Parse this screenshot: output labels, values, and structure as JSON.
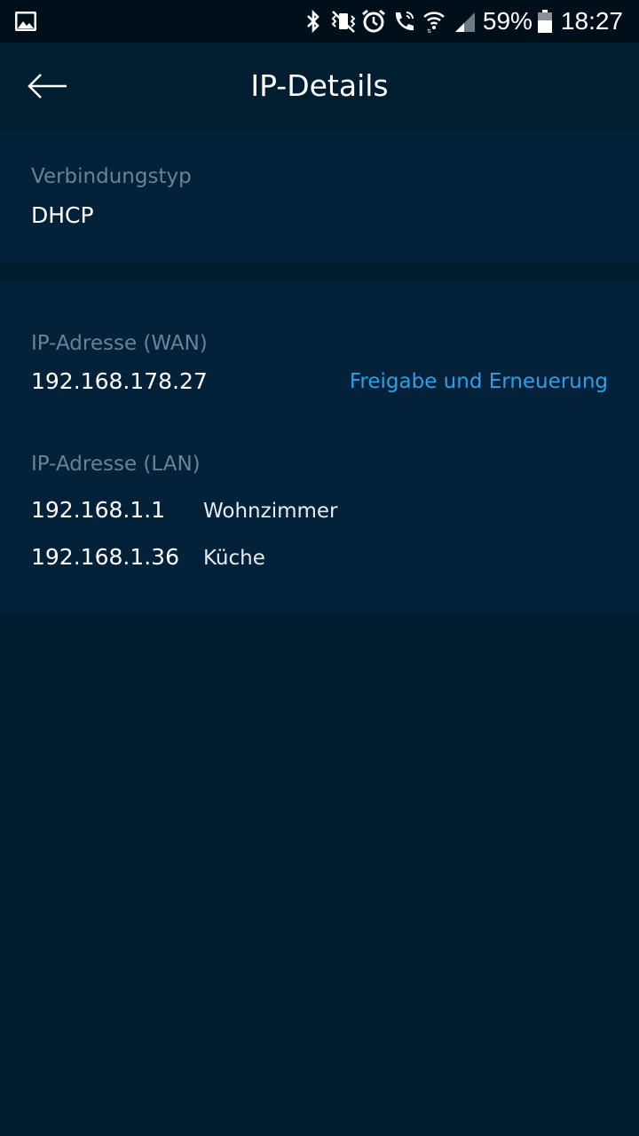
{
  "status_bar": {
    "left_icons": [
      "gallery-icon"
    ],
    "right_icons": [
      "bluetooth-icon",
      "vibrate-icon",
      "alarm-icon",
      "wifi-calling-icon",
      "wifi-icon",
      "signal-icon"
    ],
    "battery_percent": "59%",
    "time": "18:27"
  },
  "app_bar": {
    "back_icon": "arrow-left-icon",
    "title": "IP-Details"
  },
  "connection": {
    "label": "Verbindungstyp",
    "value": "DHCP"
  },
  "wan": {
    "label": "IP-Adresse (WAN)",
    "ip": "192.168.178.27",
    "action_label": "Freigabe und Erneuerung"
  },
  "lan": {
    "label": "IP-Adresse (LAN)",
    "entries": [
      {
        "ip": "192.168.1.1",
        "name": "Wohnzimmer"
      },
      {
        "ip": "192.168.1.36",
        "name": "Küche"
      }
    ]
  },
  "colors": {
    "background": "#001d30",
    "card": "#03223a",
    "accent": "#2f9ee6",
    "label": "#6c8193"
  }
}
